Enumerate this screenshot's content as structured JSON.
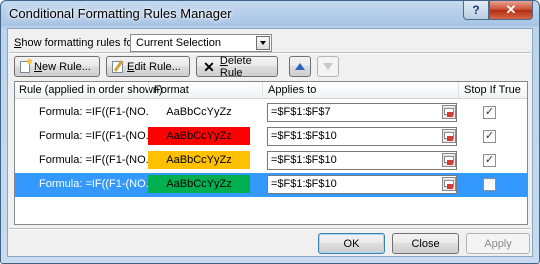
{
  "window": {
    "title": "Conditional Formatting Rules Manager",
    "help": "?",
    "close": "✕"
  },
  "show": {
    "label_pre": "",
    "label_u": "S",
    "label_post": "how formatting rules for:",
    "value": "Current Selection"
  },
  "toolbar": {
    "new_u": "N",
    "new_rest": "ew Rule...",
    "edit_u": "E",
    "edit_rest": "dit Rule...",
    "delete_u": "D",
    "delete_rest": "elete Rule"
  },
  "columns": {
    "rule": "Rule (applied in order shown)",
    "format": "Format",
    "applies": "Applies to",
    "stop": "Stop If True"
  },
  "rules": [
    {
      "rule": "Formula: =IF((F1-(NO...",
      "format": "AaBbCcYyZz",
      "bg": "#ffffff",
      "fg": "#000000",
      "applies": "=$F$1:$F$7",
      "stop": "✓",
      "selected": false
    },
    {
      "rule": "Formula: =IF((F1-(NO...",
      "format": "AaBbCcYyZz",
      "bg": "#ff0000",
      "fg": "#000000",
      "applies": "=$F$1:$F$10",
      "stop": "✓",
      "selected": false
    },
    {
      "rule": "Formula: =IF((F1-(NO...",
      "format": "AaBbCcYyZz",
      "bg": "#ffc000",
      "fg": "#000000",
      "applies": "=$F$1:$F$10",
      "stop": "✓",
      "selected": false
    },
    {
      "rule": "Formula: =IF((F1-(NO...",
      "format": "AaBbCcYyZz",
      "bg": "#00b050",
      "fg": "#000000",
      "applies": "=$F$1:$F$10",
      "stop": "",
      "selected": true
    }
  ],
  "footer": {
    "ok": "OK",
    "close": "Close",
    "apply": "Apply"
  }
}
